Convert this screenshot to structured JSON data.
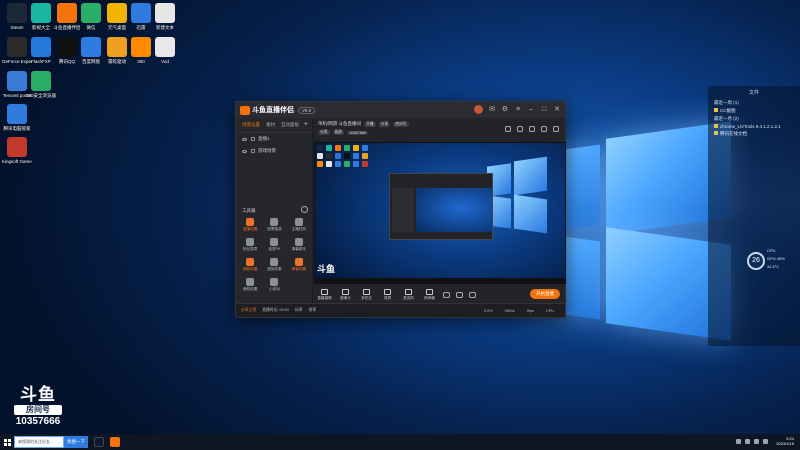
{
  "desktop_icons": [
    {
      "label": "Steam",
      "icon": "steam-icon",
      "color": "#1b2838"
    },
    {
      "label": "影视大全",
      "icon": "video-app-icon",
      "color": "#19b6a0"
    },
    {
      "label": "斗鱼直播伴侣",
      "icon": "douyu-icon",
      "color": "#f5730a"
    },
    {
      "label": "微信",
      "icon": "wechat-icon",
      "color": "#2aae67"
    },
    {
      "label": "元气桌面",
      "icon": "desktop-theme-icon",
      "color": "#f2b400"
    },
    {
      "label": "迅雷",
      "icon": "thunder-icon",
      "color": "#2f7be0"
    },
    {
      "label": "新建文本",
      "icon": "text-file-icon",
      "color": "#e6e6e6"
    },
    {
      "label": "GeForce Experience",
      "icon": "nvidia-icon",
      "color": "#2a2a2a"
    },
    {
      "label": "FlashFXP",
      "icon": "flash-icon",
      "color": "#2478d8"
    },
    {
      "label": "腾讯QQ",
      "icon": "qq-icon",
      "color": "#111111"
    },
    {
      "label": "百度网盘",
      "icon": "baidu-pan-icon",
      "color": "#2f7be0"
    },
    {
      "label": "雷蛇驱动",
      "icon": "razer-icon",
      "color": "#f0a020"
    },
    {
      "label": "360",
      "icon": "360-icon",
      "color": "#ff8a00"
    },
    {
      "label": "Vod",
      "icon": "vod-icon",
      "color": "#e8e8e8"
    },
    {
      "label": "Tencent portal",
      "icon": "computer-icon",
      "color": "#3a7bd5"
    },
    {
      "label": "360安全浏览器",
      "icon": "browser-icon",
      "color": "#2aae67"
    },
    {
      "label": "腾讯电脑管家",
      "icon": "tencent-manager-icon",
      "color": "#2f7be0"
    },
    {
      "label": "Kingsoft Game Be...",
      "icon": "kingsoft-icon",
      "color": "#c23a2a"
    }
  ],
  "watermark": {
    "logo": "斗鱼",
    "sub": "房间号",
    "room": "10357666"
  },
  "side_panel": {
    "title": "文件",
    "rows": [
      "最近一周 (1)",
      "CC截图",
      "最近一月 (2)",
      "chrome_LiVTools 9.4.1.2.1.2.1",
      "腾讯在线文档"
    ]
  },
  "temp_widget": {
    "value": "26",
    "lines": [
      "CPU",
      "GPU 45%",
      "34.5°C"
    ]
  },
  "app": {
    "brand": "斗鱼直播伴侣",
    "version": "V6.0",
    "left_tabs": [
      "场景设置",
      "素材",
      "互动面板"
    ],
    "scenes": [
      "直播1",
      "游戏场景"
    ],
    "tools_title": "工具箱",
    "tools": [
      {
        "label": "直播设置",
        "accent": true
      },
      {
        "label": "投票抽奖",
        "accent": false
      },
      {
        "label": "主播任务",
        "accent": false
      },
      {
        "label": "粉丝勋章",
        "accent": false
      },
      {
        "label": "连麦PK",
        "accent": false
      },
      {
        "label": "弹幕助手",
        "accent": false
      },
      {
        "label": "视频设置",
        "accent": true
      },
      {
        "label": "虚拟形象",
        "accent": false
      },
      {
        "label": "弹幕设置",
        "accent": true
      },
      {
        "label": "美颜设置",
        "accent": false
      },
      {
        "label": "小游戏",
        "accent": false
      }
    ],
    "room_title": "单机/网游 斗鱼直播间",
    "room_chips": [
      "开播",
      "分享",
      "房间号"
    ],
    "room_line2": [
      "分类",
      "画质",
      "10357666"
    ],
    "bottom_controls": [
      "直播摄像",
      "摄像头",
      "多机位",
      "录屏",
      "麦克风",
      "扬声器"
    ],
    "go_live": "开始直播",
    "status": [
      "分享正常",
      "直播时长: 00:00",
      "码率",
      "帧率"
    ],
    "status_right": [
      "0.0%",
      "0KB/s",
      "0fps",
      "CPU"
    ]
  },
  "taskbar": {
    "search_placeholder": "来搜我的关注好友...",
    "search_button": "找搜一下",
    "time": "9:24",
    "date": "2023/1/15"
  },
  "colors": {
    "accent": "#f5730a",
    "desktop": "#0b3d86"
  }
}
